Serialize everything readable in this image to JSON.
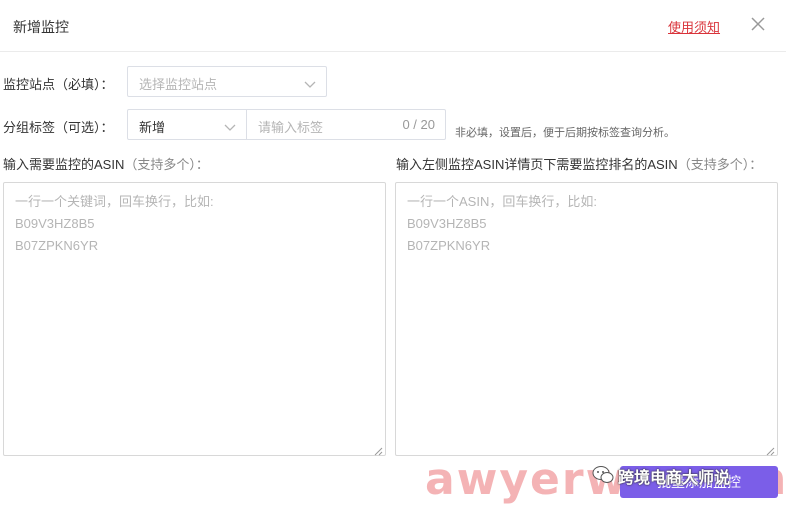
{
  "header": {
    "title": "新增监控",
    "usage_link": "使用须知"
  },
  "site": {
    "label": "监控站点（必填）：",
    "placeholder": "选择监控站点"
  },
  "group": {
    "label": "分组标签（可选）：",
    "selected": "新增",
    "input_placeholder": "请输入标签",
    "counter": "0 / 20",
    "hint": "非必填，设置后，便于后期按标签查询分析。"
  },
  "left_area": {
    "label": "输入需要监控的ASIN",
    "sub": "（支持多个）：",
    "placeholder_lines": [
      "一行一个关键词，回车换行，比如:",
      "B09V3HZ8B5",
      "B07ZPKN6YR"
    ]
  },
  "right_area": {
    "label": "输入左侧监控ASIN详情页下需要监控排名的ASIN",
    "sub": "（支持多个）：",
    "placeholder_lines": [
      "一行一个ASIN，回车换行，比如:",
      "B09V3HZ8B5",
      "B07ZPKN6YR"
    ]
  },
  "footer": {
    "submit_label": "批量添加监控",
    "watermark": "awyerwu.com",
    "wechat_text": "跨境电商大师说"
  },
  "icons": {
    "close": "close-icon",
    "chevron": "chevron-down-icon",
    "wechat": "wechat-icon"
  },
  "colors": {
    "link": "#d9333a",
    "primary": "#7b5ee8",
    "border": "#dcdfe6"
  }
}
